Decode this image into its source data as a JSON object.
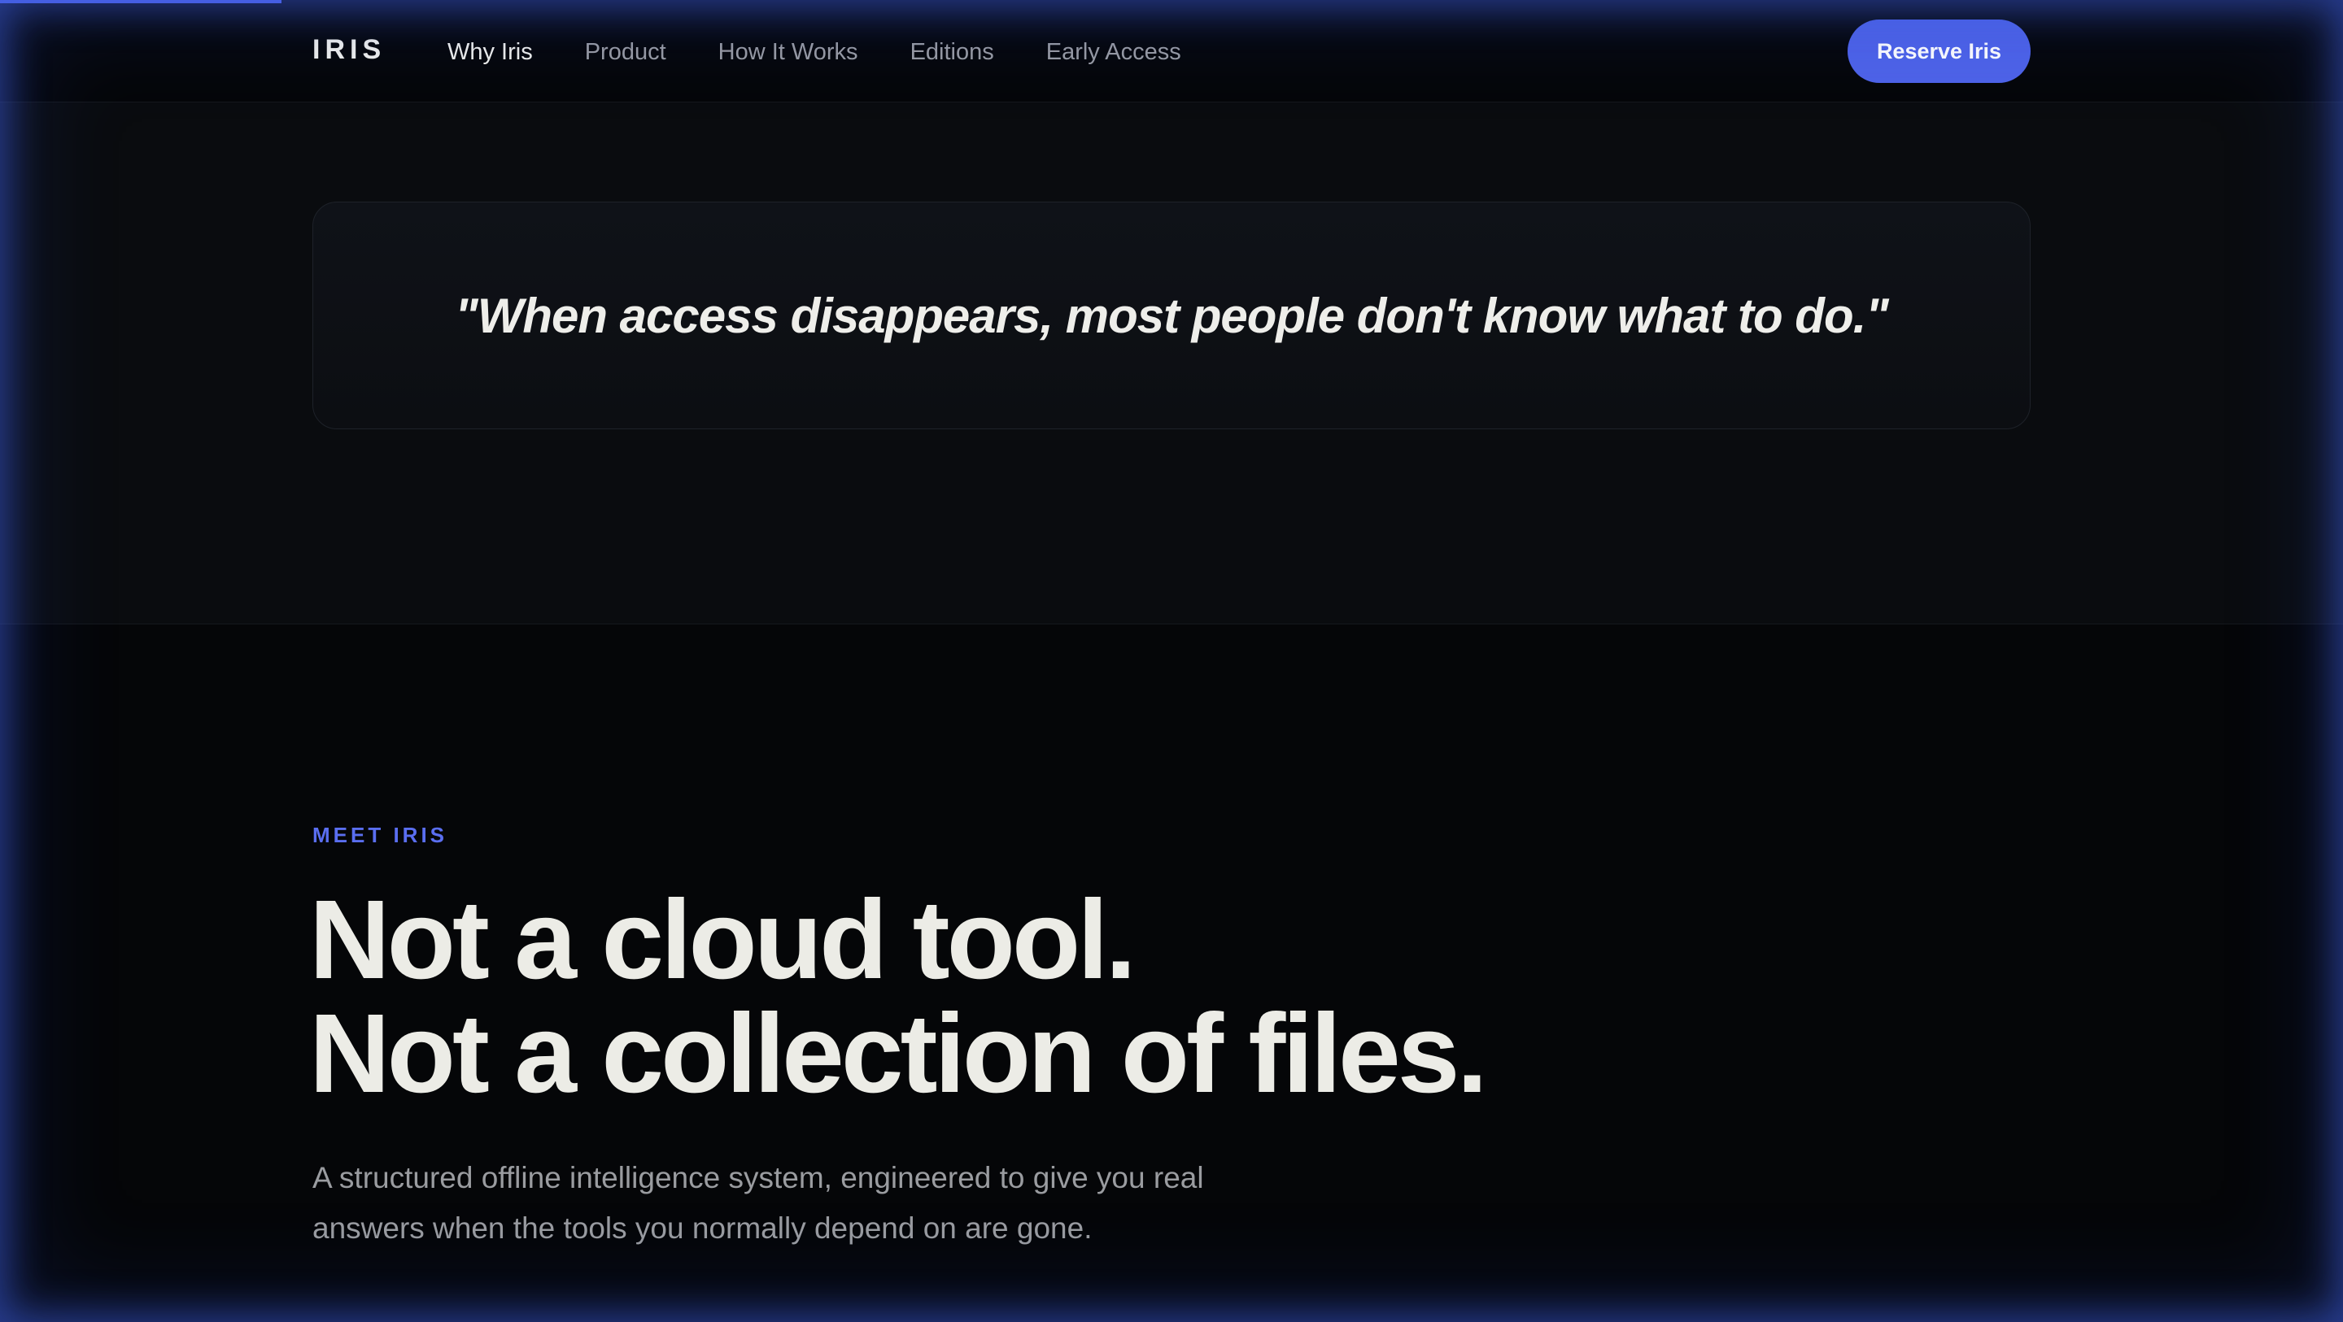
{
  "progress": {
    "value_percent": 12
  },
  "nav": {
    "logo": "IRIS",
    "links": [
      {
        "label": "Why Iris",
        "active": true
      },
      {
        "label": "Product",
        "active": false
      },
      {
        "label": "How It Works",
        "active": false
      },
      {
        "label": "Editions",
        "active": false
      },
      {
        "label": "Early Access",
        "active": false
      }
    ],
    "cta_label": "Reserve Iris"
  },
  "quote": {
    "text": "\"When access disappears, most people don't know what to do.\""
  },
  "meet": {
    "eyebrow": "MEET IRIS",
    "headline_line1": "Not a cloud tool.",
    "headline_line2": "Not a collection of files.",
    "lede": "A structured offline intelligence system, engineered to give you real answers when the tools you normally depend on are gone."
  },
  "colors": {
    "accent": "#4e63e8",
    "eyebrow": "#5a6ef0",
    "background": "#050608",
    "text_primary": "#ecece6",
    "text_muted": "#9a9ca0"
  }
}
